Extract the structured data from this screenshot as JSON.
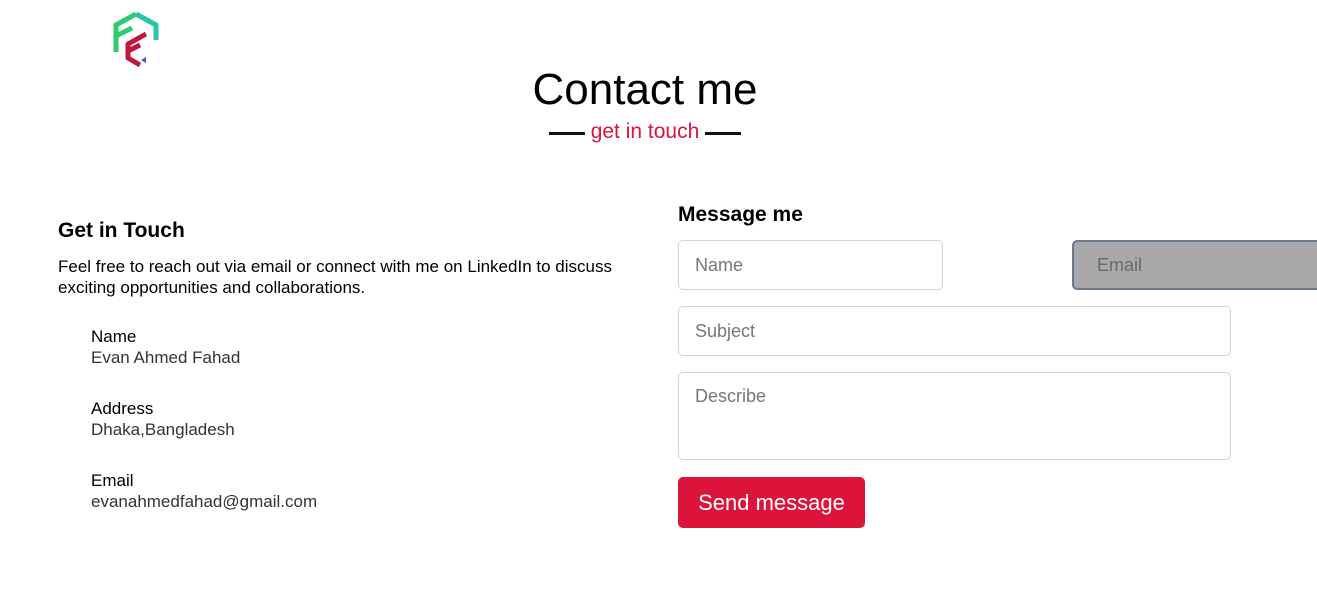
{
  "header": {
    "title": "Contact me",
    "subtitle": "get in touch"
  },
  "contact_info": {
    "heading": "Get in Touch",
    "intro": "Feel free to reach out via email or connect with me on LinkedIn to discuss exciting opportunities and collaborations.",
    "items": [
      {
        "label": "Name",
        "value": "Evan Ahmed Fahad"
      },
      {
        "label": "Address",
        "value": "Dhaka,Bangladesh"
      },
      {
        "label": "Email",
        "value": "evanahmedfahad@gmail.com"
      }
    ]
  },
  "form": {
    "heading": "Message me",
    "name_placeholder": "Name",
    "email_placeholder": "Email",
    "subject_placeholder": "Subject",
    "describe_placeholder": "Describe",
    "send_label": "Send message"
  },
  "colors": {
    "accent": "#dc143c",
    "logo_green": "#2ecc71",
    "logo_teal": "#1abc9c",
    "logo_red": "#c0173f",
    "logo_blue": "#3b5bdb"
  },
  "icons": {
    "logo": "fe-hexagon-logo"
  }
}
